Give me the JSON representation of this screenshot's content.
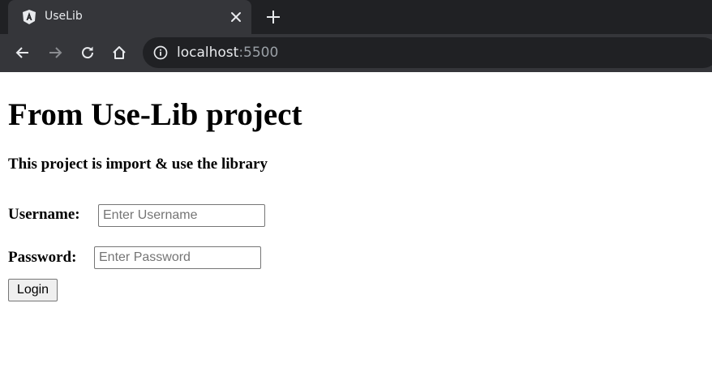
{
  "browser": {
    "tab_title": "UseLib",
    "url_host": "localhost",
    "url_port": ":5500"
  },
  "page": {
    "heading": "From Use-Lib project",
    "subheading": "This project is import & use the library",
    "username_label": "Username:",
    "username_placeholder": "Enter Username",
    "password_label": "Password:",
    "password_placeholder": "Enter Password",
    "login_button": "Login"
  }
}
